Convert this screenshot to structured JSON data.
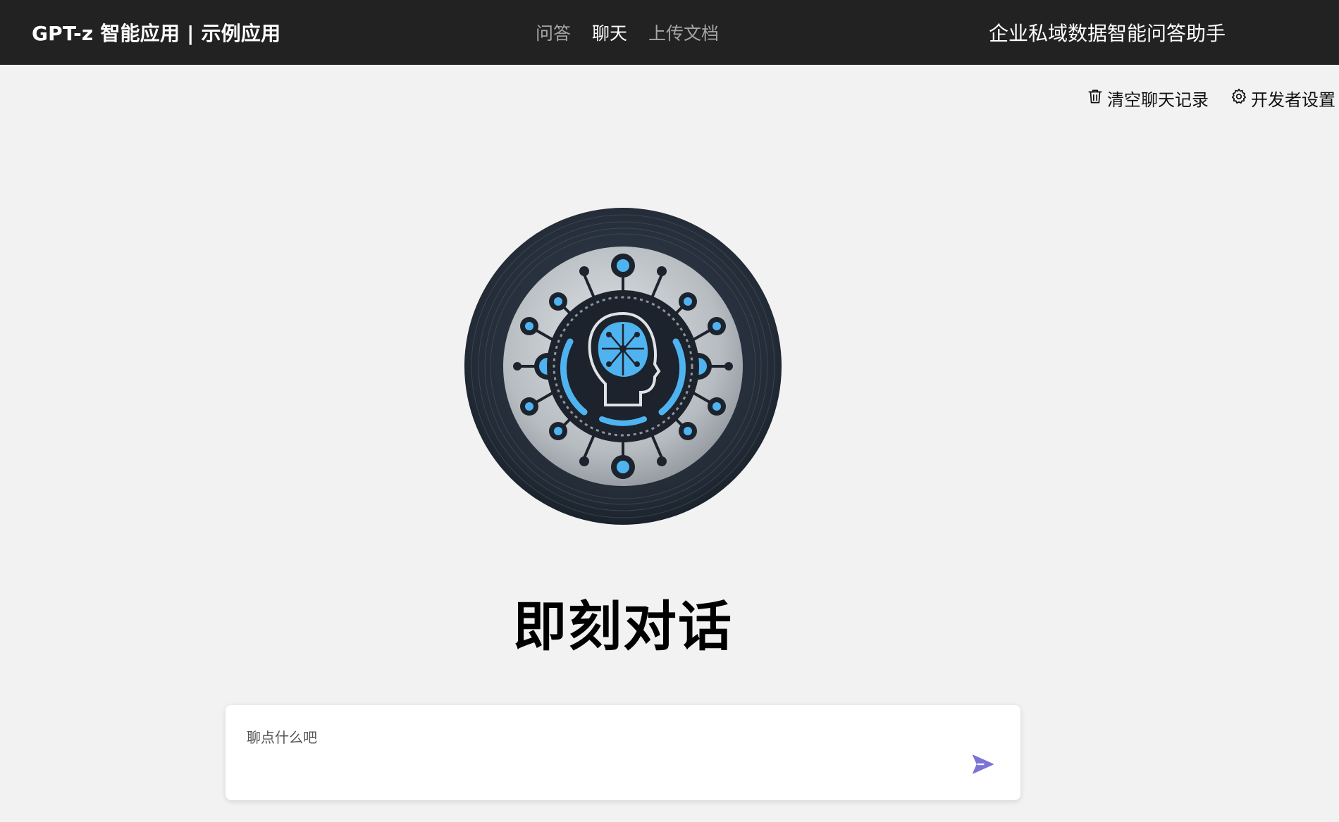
{
  "header": {
    "brand": "GPT-z 智能应用 | 示例应用",
    "nav": [
      {
        "label": "问答",
        "active": false
      },
      {
        "label": "聊天",
        "active": true
      },
      {
        "label": "上传文档",
        "active": false
      }
    ],
    "right_title": "企业私域数据智能问答助手"
  },
  "toolbar": {
    "clear_label": "清空聊天记录",
    "clear_icon": "trash-icon",
    "settings_label": "开发者设置",
    "settings_icon": "gear-icon"
  },
  "main": {
    "title": "即刻对话"
  },
  "chat": {
    "placeholder": "聊点什么吧",
    "send_icon": "send-icon"
  },
  "colors": {
    "header_bg": "#222222",
    "page_bg": "#f2f2f2",
    "accent_blue": "#4fb3f0",
    "send_icon": "#7b74d6"
  }
}
